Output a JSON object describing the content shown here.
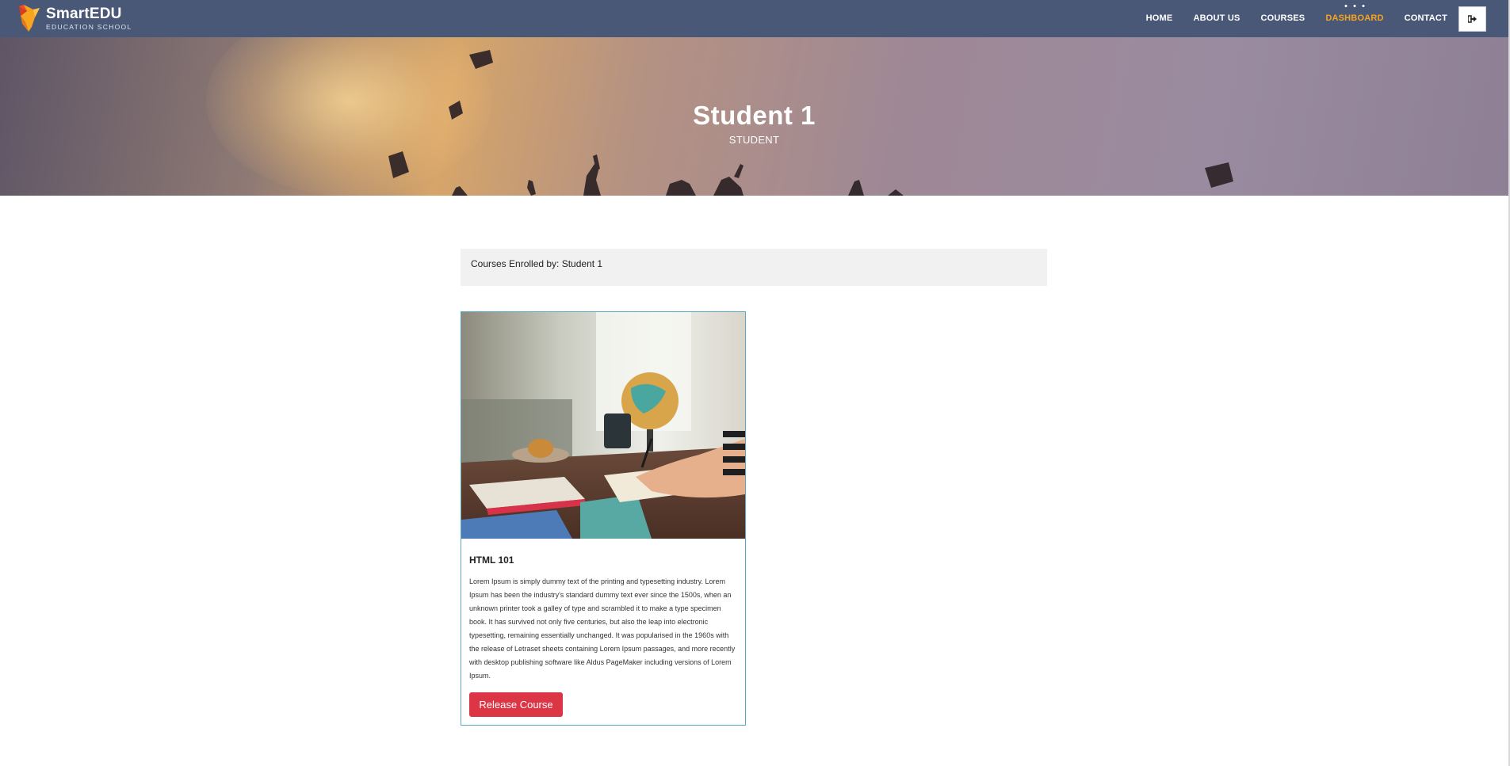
{
  "brand": {
    "name": "SmartEDU",
    "tagline": "EDUCATION SCHOOL"
  },
  "nav": {
    "items": [
      {
        "label": "HOME"
      },
      {
        "label": "ABOUT US"
      },
      {
        "label": "COURSES"
      },
      {
        "label": "DASHBOARD",
        "active": true
      },
      {
        "label": "CONTACT"
      }
    ],
    "logout_icon": "sign-out-icon",
    "active_color": "#f7a51e",
    "bar_color": "#4a5878"
  },
  "hero": {
    "title": "Student 1",
    "subtitle": "STUDENT"
  },
  "enrolled": {
    "text": "Courses Enrolled by: Student 1"
  },
  "courses": [
    {
      "title": "HTML 101",
      "description": "Lorem Ipsum is simply dummy text of the printing and typesetting industry. Lorem Ipsum has been the industry's standard dummy text ever since the 1500s, when an unknown printer took a galley of type and scrambled it to make a type specimen book. It has survived not only five centuries, but also the leap into electronic typesetting, remaining essentially unchanged. It was popularised in the 1960s with the release of Letraset sheets containing Lorem Ipsum passages, and more recently with desktop publishing software like Aldus PageMaker including versions of Lorem Ipsum.",
      "button_label": "Release Course",
      "button_color": "#dc3545"
    }
  ]
}
